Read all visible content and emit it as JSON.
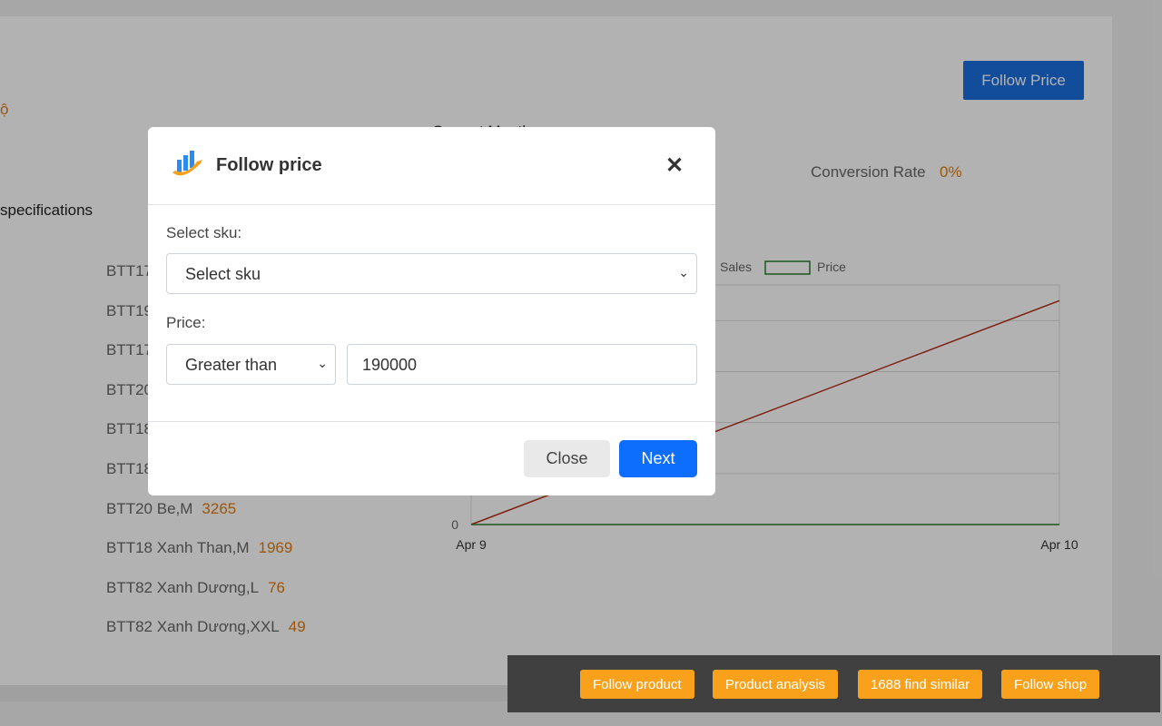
{
  "page": {
    "follow_price_button": "Follow Price",
    "orange_fragment": "ộ",
    "current_month": "Current Month",
    "conversion_rate_label": "Conversion Rate",
    "conversion_rate_value": "0%",
    "specifications_label": "specifications",
    "sku_rows": [
      {
        "name": "BTT17",
        "value": ""
      },
      {
        "name": "BTT19",
        "value": ""
      },
      {
        "name": "BTT17",
        "value": ""
      },
      {
        "name": "BTT20",
        "value": ""
      },
      {
        "name": "BTT18",
        "value": ""
      },
      {
        "name": "BTT18",
        "value": ""
      },
      {
        "name": "BTT20 Be,M",
        "value": "3265"
      },
      {
        "name": "BTT18 Xanh Than,M",
        "value": "1969"
      },
      {
        "name": "BTT82 Xanh Dương,L",
        "value": "76"
      },
      {
        "name": "BTT82 Xanh Dương,XXL",
        "value": "49"
      }
    ]
  },
  "chart_data": {
    "type": "line",
    "categories": [
      "Apr 9",
      "Apr 10"
    ],
    "series": [
      {
        "name": "Sales",
        "color": "#b5301a",
        "values": [
          0,
          1
        ]
      },
      {
        "name": "Price",
        "color": "#2a7a2a",
        "values": [
          0,
          0
        ]
      }
    ],
    "y_tick_visible": "0",
    "grid": true,
    "legend": "top"
  },
  "modal": {
    "title": "Follow price",
    "icon": "chart-growth-icon",
    "sku_label": "Select sku:",
    "sku_selected": "Select sku",
    "price_label": "Price:",
    "comparison_selected": "Greater than",
    "price_value": "190000",
    "close_button": "Close",
    "next_button": "Next"
  },
  "toolbar": {
    "buttons": [
      "Follow product",
      "Product analysis",
      "1688 find similar",
      "Follow shop"
    ]
  }
}
